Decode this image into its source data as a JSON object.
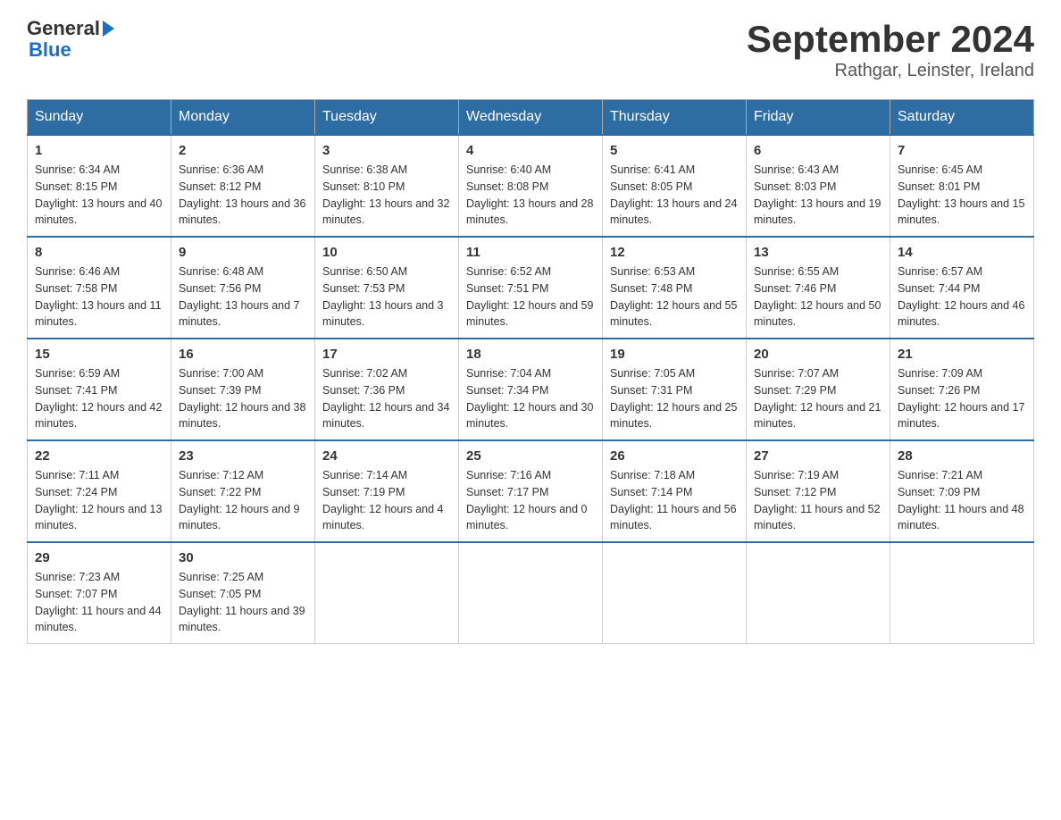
{
  "header": {
    "logo_text_general": "General",
    "logo_text_blue": "Blue",
    "month_year": "September 2024",
    "location": "Rathgar, Leinster, Ireland"
  },
  "days_of_week": [
    "Sunday",
    "Monday",
    "Tuesday",
    "Wednesday",
    "Thursday",
    "Friday",
    "Saturday"
  ],
  "weeks": [
    [
      {
        "day": "1",
        "sunrise": "6:34 AM",
        "sunset": "8:15 PM",
        "daylight": "13 hours and 40 minutes."
      },
      {
        "day": "2",
        "sunrise": "6:36 AM",
        "sunset": "8:12 PM",
        "daylight": "13 hours and 36 minutes."
      },
      {
        "day": "3",
        "sunrise": "6:38 AM",
        "sunset": "8:10 PM",
        "daylight": "13 hours and 32 minutes."
      },
      {
        "day": "4",
        "sunrise": "6:40 AM",
        "sunset": "8:08 PM",
        "daylight": "13 hours and 28 minutes."
      },
      {
        "day": "5",
        "sunrise": "6:41 AM",
        "sunset": "8:05 PM",
        "daylight": "13 hours and 24 minutes."
      },
      {
        "day": "6",
        "sunrise": "6:43 AM",
        "sunset": "8:03 PM",
        "daylight": "13 hours and 19 minutes."
      },
      {
        "day": "7",
        "sunrise": "6:45 AM",
        "sunset": "8:01 PM",
        "daylight": "13 hours and 15 minutes."
      }
    ],
    [
      {
        "day": "8",
        "sunrise": "6:46 AM",
        "sunset": "7:58 PM",
        "daylight": "13 hours and 11 minutes."
      },
      {
        "day": "9",
        "sunrise": "6:48 AM",
        "sunset": "7:56 PM",
        "daylight": "13 hours and 7 minutes."
      },
      {
        "day": "10",
        "sunrise": "6:50 AM",
        "sunset": "7:53 PM",
        "daylight": "13 hours and 3 minutes."
      },
      {
        "day": "11",
        "sunrise": "6:52 AM",
        "sunset": "7:51 PM",
        "daylight": "12 hours and 59 minutes."
      },
      {
        "day": "12",
        "sunrise": "6:53 AM",
        "sunset": "7:48 PM",
        "daylight": "12 hours and 55 minutes."
      },
      {
        "day": "13",
        "sunrise": "6:55 AM",
        "sunset": "7:46 PM",
        "daylight": "12 hours and 50 minutes."
      },
      {
        "day": "14",
        "sunrise": "6:57 AM",
        "sunset": "7:44 PM",
        "daylight": "12 hours and 46 minutes."
      }
    ],
    [
      {
        "day": "15",
        "sunrise": "6:59 AM",
        "sunset": "7:41 PM",
        "daylight": "12 hours and 42 minutes."
      },
      {
        "day": "16",
        "sunrise": "7:00 AM",
        "sunset": "7:39 PM",
        "daylight": "12 hours and 38 minutes."
      },
      {
        "day": "17",
        "sunrise": "7:02 AM",
        "sunset": "7:36 PM",
        "daylight": "12 hours and 34 minutes."
      },
      {
        "day": "18",
        "sunrise": "7:04 AM",
        "sunset": "7:34 PM",
        "daylight": "12 hours and 30 minutes."
      },
      {
        "day": "19",
        "sunrise": "7:05 AM",
        "sunset": "7:31 PM",
        "daylight": "12 hours and 25 minutes."
      },
      {
        "day": "20",
        "sunrise": "7:07 AM",
        "sunset": "7:29 PM",
        "daylight": "12 hours and 21 minutes."
      },
      {
        "day": "21",
        "sunrise": "7:09 AM",
        "sunset": "7:26 PM",
        "daylight": "12 hours and 17 minutes."
      }
    ],
    [
      {
        "day": "22",
        "sunrise": "7:11 AM",
        "sunset": "7:24 PM",
        "daylight": "12 hours and 13 minutes."
      },
      {
        "day": "23",
        "sunrise": "7:12 AM",
        "sunset": "7:22 PM",
        "daylight": "12 hours and 9 minutes."
      },
      {
        "day": "24",
        "sunrise": "7:14 AM",
        "sunset": "7:19 PM",
        "daylight": "12 hours and 4 minutes."
      },
      {
        "day": "25",
        "sunrise": "7:16 AM",
        "sunset": "7:17 PM",
        "daylight": "12 hours and 0 minutes."
      },
      {
        "day": "26",
        "sunrise": "7:18 AM",
        "sunset": "7:14 PM",
        "daylight": "11 hours and 56 minutes."
      },
      {
        "day": "27",
        "sunrise": "7:19 AM",
        "sunset": "7:12 PM",
        "daylight": "11 hours and 52 minutes."
      },
      {
        "day": "28",
        "sunrise": "7:21 AM",
        "sunset": "7:09 PM",
        "daylight": "11 hours and 48 minutes."
      }
    ],
    [
      {
        "day": "29",
        "sunrise": "7:23 AM",
        "sunset": "7:07 PM",
        "daylight": "11 hours and 44 minutes."
      },
      {
        "day": "30",
        "sunrise": "7:25 AM",
        "sunset": "7:05 PM",
        "daylight": "11 hours and 39 minutes."
      },
      null,
      null,
      null,
      null,
      null
    ]
  ],
  "labels": {
    "sunrise_prefix": "Sunrise: ",
    "sunset_prefix": "Sunset: ",
    "daylight_prefix": "Daylight: "
  }
}
